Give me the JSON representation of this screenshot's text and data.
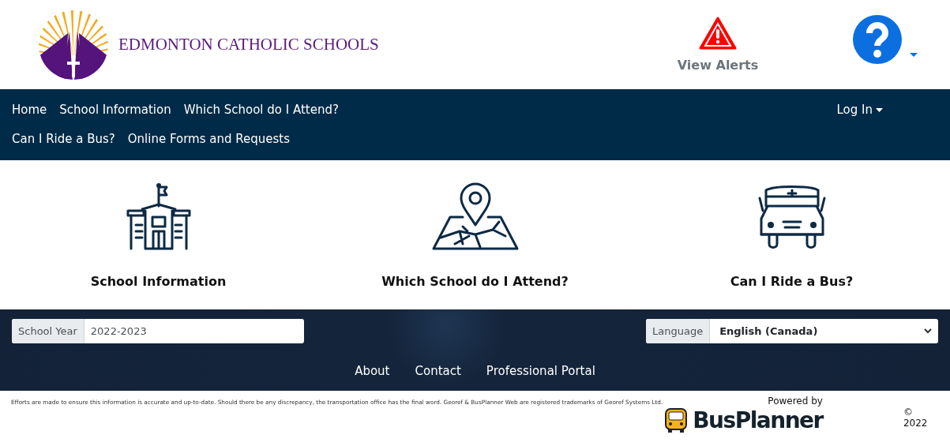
{
  "header": {
    "brand": "EDMONTON CATHOLIC SCHOOLS",
    "alerts_label": "View Alerts"
  },
  "nav": {
    "items": [
      {
        "label": "Home"
      },
      {
        "label": "School Information"
      },
      {
        "label": "Which School do I Attend?"
      },
      {
        "label": "Can I Ride a Bus?"
      },
      {
        "label": "Online Forms and Requests"
      }
    ],
    "login": "Log In"
  },
  "tiles": [
    {
      "kind": "school",
      "label": "School Information"
    },
    {
      "kind": "map",
      "label": "Which School do I Attend?"
    },
    {
      "kind": "bus",
      "label": "Can I Ride a Bus?"
    }
  ],
  "footer": {
    "school_year": {
      "label": "School Year",
      "value": "2022-2023"
    },
    "language": {
      "label": "Language",
      "value": "English (Canada)"
    },
    "links": [
      "About",
      "Contact",
      "Professional Portal"
    ]
  },
  "bottom": {
    "disclaimer": "Efforts are made to ensure this information is accurate and up-to-date. Should there be any discrepancy, the transportation office has the final word. Georef & BusPlanner Web are registered trademarks of Georef Systems Ltd.",
    "powered_by": "Powered by",
    "brand": "BusPlanner",
    "copyright": "© 2022"
  }
}
